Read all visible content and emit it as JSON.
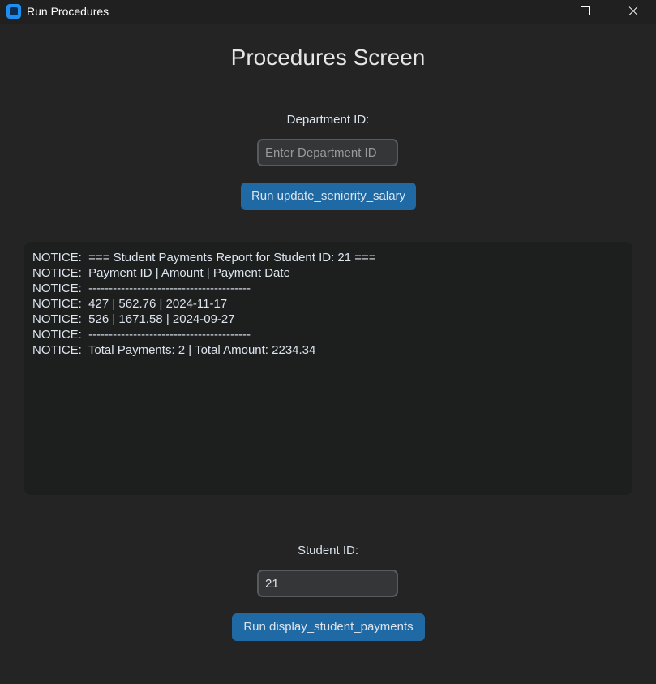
{
  "window": {
    "title": "Run Procedures"
  },
  "heading": "Procedures Screen",
  "department": {
    "label": "Department ID:",
    "placeholder": "Enter Department ID",
    "value": "",
    "button_label": "Run update_seniority_salary"
  },
  "output": {
    "lines": [
      "NOTICE:  === Student Payments Report for Student ID: 21 ===",
      "NOTICE:  Payment ID | Amount | Payment Date",
      "NOTICE:  ----------------------------------------",
      "NOTICE:  427 | 562.76 | 2024-11-17",
      "NOTICE:  526 | 1671.58 | 2024-09-27",
      "NOTICE:  ----------------------------------------",
      "NOTICE:  Total Payments: 2 | Total Amount: 2234.34"
    ]
  },
  "student": {
    "label": "Student ID:",
    "placeholder": "",
    "value": "21",
    "button_label": "Run display_student_payments"
  },
  "colors": {
    "background": "#242424",
    "button": "#1f6aa5",
    "textbox": "#1d1e1e",
    "entry_border": "#565b5e"
  },
  "icons": {
    "app": "app-icon",
    "minimize": "minimize-icon",
    "maximize": "maximize-icon",
    "close": "close-icon"
  }
}
